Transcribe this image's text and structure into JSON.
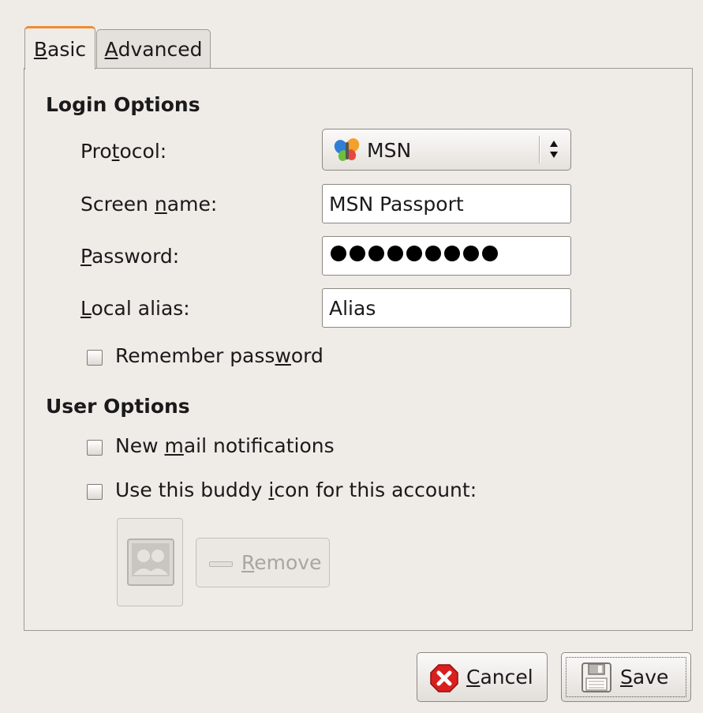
{
  "tabs": [
    {
      "label_prefix": "",
      "mnemonic": "B",
      "label_suffix": "asic",
      "selected": true
    },
    {
      "label_prefix": "",
      "mnemonic": "A",
      "label_suffix": "dvanced",
      "selected": false
    }
  ],
  "login_options": {
    "title": "Login Options",
    "protocol": {
      "label_prefix": "Pro",
      "mnemonic": "t",
      "label_suffix": "ocol:",
      "value": "MSN",
      "icon": "msn-butterfly-icon"
    },
    "screen_name": {
      "label_prefix": "Screen ",
      "mnemonic": "n",
      "label_suffix": "ame:",
      "value": "MSN Passport"
    },
    "password": {
      "label_prefix": "",
      "mnemonic": "P",
      "label_suffix": "assword:",
      "masked_length": 9
    },
    "local_alias": {
      "label_prefix": "",
      "mnemonic": "L",
      "label_suffix": "ocal alias:",
      "value": "Alias"
    },
    "remember_password": {
      "label_prefix": "Remember pass",
      "mnemonic": "w",
      "label_suffix": "ord",
      "checked": false
    }
  },
  "user_options": {
    "title": "User Options",
    "new_mail": {
      "label_prefix": "New ",
      "mnemonic": "m",
      "label_suffix": "ail notifications",
      "checked": false
    },
    "buddy_icon": {
      "label_prefix": "Use this buddy ",
      "mnemonic": "i",
      "label_suffix": "con for this account:",
      "checked": false
    },
    "remove_button": {
      "label_prefix": "",
      "mnemonic": "R",
      "label_suffix": "emove",
      "enabled": false
    }
  },
  "buttons": {
    "cancel": {
      "label_prefix": "",
      "mnemonic": "C",
      "label_suffix": "ancel"
    },
    "save": {
      "label_prefix": "",
      "mnemonic": "S",
      "label_suffix": "ave"
    }
  },
  "colors": {
    "tab_accent": "#f08b32",
    "background": "#efebe7",
    "cancel_icon": "#d8201f"
  }
}
